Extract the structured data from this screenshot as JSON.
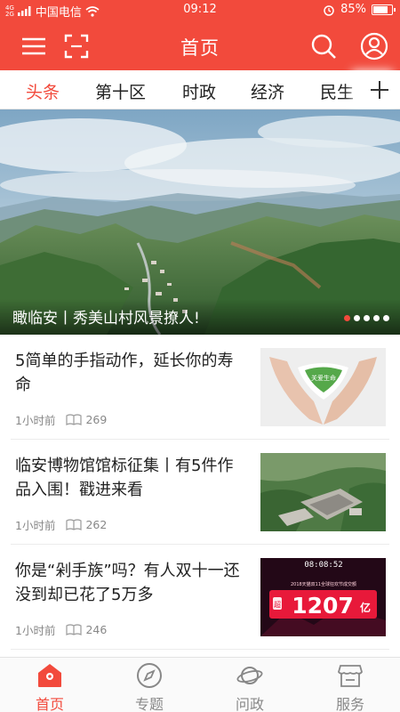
{
  "status_bar": {
    "signal_top": "4G",
    "signal_bottom": "2G",
    "carrier": "中国电信",
    "time": "09:12",
    "battery_text": "85%",
    "battery_level": 0.85
  },
  "app_bar": {
    "title": "首页",
    "left_icons": [
      "menu-icon",
      "scan-icon"
    ],
    "right_icons": [
      "search-icon",
      "profile-icon"
    ]
  },
  "tabs": {
    "items": [
      {
        "label": "头条",
        "active": true
      },
      {
        "label": "第十区",
        "active": false
      },
      {
        "label": "时政",
        "active": false
      },
      {
        "label": "经济",
        "active": false
      },
      {
        "label": "民生",
        "active": false
      }
    ],
    "add_icon": "plus-icon"
  },
  "banner": {
    "caption": "瞰临安丨秀美山村风景撩人!",
    "slide_count": 5,
    "active_slide": 1
  },
  "news": [
    {
      "title": "5简单的手指动作，延长你的寿命",
      "time": "1小时前",
      "reads": "269"
    },
    {
      "title": "临安博物馆馆标征集丨有5件作品入围！戳进来看",
      "time": "1小时前",
      "reads": "262"
    },
    {
      "title": "你是“剁手族”吗？有人双十一还没到却已花了5万多",
      "time": "1小时前",
      "reads": "246"
    }
  ],
  "thumb_text": {
    "card_text": "关爱生命",
    "timer": "08:08:52",
    "subtitle": "2018天猫双11全球狂欢节成交额",
    "amount": "1207",
    "unit": "亿",
    "badge": "超"
  },
  "bottom_nav": [
    {
      "label": "首页",
      "icon": "home-icon",
      "active": true
    },
    {
      "label": "专题",
      "icon": "compass-icon",
      "active": false
    },
    {
      "label": "问政",
      "icon": "planet-icon",
      "active": false
    },
    {
      "label": "服务",
      "icon": "store-icon",
      "active": false
    }
  ],
  "colors": {
    "accent": "#f24a3c",
    "inactive": "#888888"
  }
}
